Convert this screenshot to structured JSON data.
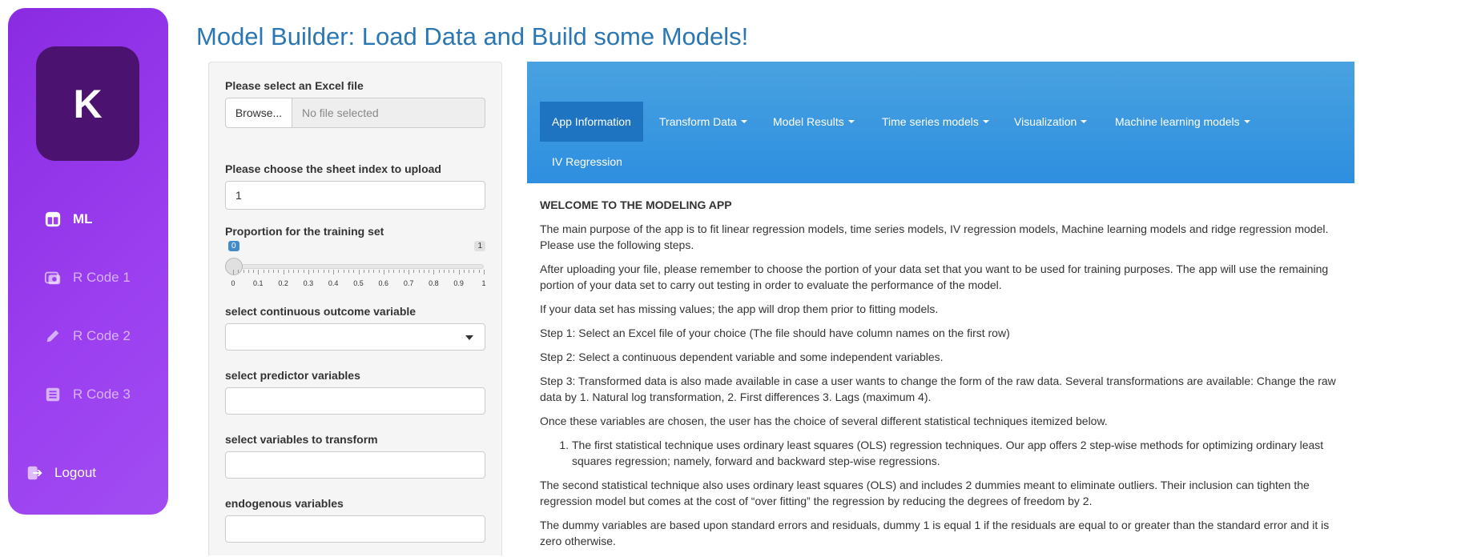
{
  "sidebar": {
    "avatar_letter": "K",
    "items": [
      {
        "label": "ML",
        "icon": "dashboard-icon",
        "active": true
      },
      {
        "label": "R Code 1",
        "icon": "photo-stack-icon",
        "active": false
      },
      {
        "label": "R Code 2",
        "icon": "pencil-icon",
        "active": false
      },
      {
        "label": "R Code 3",
        "icon": "list-icon",
        "active": false
      }
    ],
    "logout_label": "Logout",
    "background": "#8a2be2"
  },
  "title": "Model Builder: Load Data and Build some Models!",
  "form": {
    "file_label": "Please select an Excel file",
    "browse_label": "Browse...",
    "file_placeholder": "No file selected",
    "sheet_label": "Please choose the sheet index to upload",
    "sheet_value": "1",
    "proportion_label": "Proportion for the training set",
    "slider": {
      "min": "0",
      "max": "1",
      "value": 0,
      "ticks": [
        "0",
        "0.1",
        "0.2",
        "0.3",
        "0.4",
        "0.5",
        "0.6",
        "0.7",
        "0.8",
        "0.9",
        "1"
      ]
    },
    "outcome_label": "select continuous outcome variable",
    "predictor_label": "select predictor variables",
    "transform_label": "select variables to transform",
    "endogenous_label": "endogenous variables"
  },
  "tabs": [
    {
      "label": "App Information",
      "active": true,
      "dropdown": false
    },
    {
      "label": "Transform Data",
      "active": false,
      "dropdown": true
    },
    {
      "label": "Model Results",
      "active": false,
      "dropdown": true
    },
    {
      "label": "Time series models",
      "active": false,
      "dropdown": true
    },
    {
      "label": "Visualization",
      "active": false,
      "dropdown": true
    },
    {
      "label": "Machine learning models",
      "active": false,
      "dropdown": true
    },
    {
      "label": "IV Regression",
      "active": false,
      "dropdown": false
    }
  ],
  "content": {
    "heading": "WELCOME TO THE MODELING APP",
    "p1": "The main purpose of the app is to fit linear regression models, time series models, IV regression models, Machine learning models and ridge regression model. Please use the following steps.",
    "p2": "After uploading your file, please remember to choose the portion of your data set that you want to be used for training purposes. The app will use the remaining portion of your data set to carry out testing in order to evaluate the performance of the model.",
    "p3": "If your data set has missing values; the app will drop them prior to fitting models.",
    "step1": "Step 1: Select an Excel file of your choice (The file should have column names on the first row)",
    "step2": "Step 2: Select a continuous dependent variable and some independent variables.",
    "step3": "Step 3: Transformed data is also made available in case a user wants to change the form of the raw data. Several transformations are available: Change the raw data by 1. Natural log transformation, 2. First differences 3. Lags (maximum 4).",
    "p4": "Once these variables are chosen, the user has the choice of several different statistical techniques itemized below.",
    "list_item1": "The first statistical technique uses ordinary least squares (OLS) regression techniques. Our app offers 2 step-wise methods for optimizing ordinary least squares regression; namely, forward and backward step-wise regressions.",
    "p5": "The second statistical technique also uses ordinary least squares (OLS) and includes 2 dummies meant to eliminate outliers. Their inclusion can tighten the regression model but comes at the cost of “over fitting” the regression by reducing the degrees of freedom by 2.",
    "p6": "The dummy variables are based upon standard errors and residuals, dummy 1 is equal 1 if the residuals are equal to or greater than the standard error and it is zero otherwise."
  }
}
